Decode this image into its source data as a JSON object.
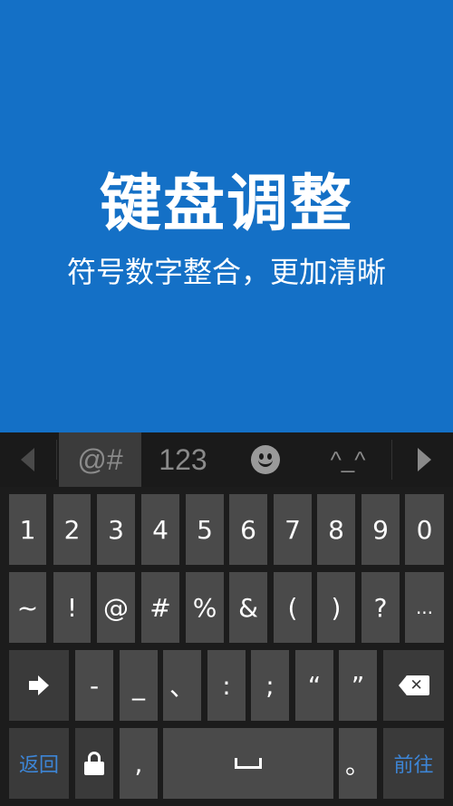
{
  "banner": {
    "title": "键盘调整",
    "subtitle": "符号数字整合，更加清晰",
    "background": "#1470c6"
  },
  "tabbar": {
    "prev_icon": "chevron-left-icon",
    "tabs": [
      {
        "label": "@#",
        "active": true
      },
      {
        "label": "123",
        "active": false
      },
      {
        "label": "",
        "icon": "smiley-icon",
        "active": false
      },
      {
        "label": "^_^",
        "active": false
      }
    ],
    "next_icon": "chevron-right-icon"
  },
  "rows": {
    "row1": [
      "1",
      "2",
      "3",
      "4",
      "5",
      "6",
      "7",
      "8",
      "9",
      "0"
    ],
    "row2": [
      "~",
      "!",
      "@",
      "#",
      "%",
      "&",
      "(",
      ")",
      "?",
      "..."
    ],
    "row3": [
      "-",
      "_",
      "、",
      ":",
      ";",
      "“",
      "”"
    ],
    "row4": {
      "back_label": "返回",
      "comma": ",",
      "period": "。",
      "go_label": "前往"
    }
  },
  "colors": {
    "key": "#4a4a4a",
    "key_dark": "#3a3a3a",
    "keyboard_bg": "#1c1c1c",
    "accent_text": "#3d85d6"
  }
}
